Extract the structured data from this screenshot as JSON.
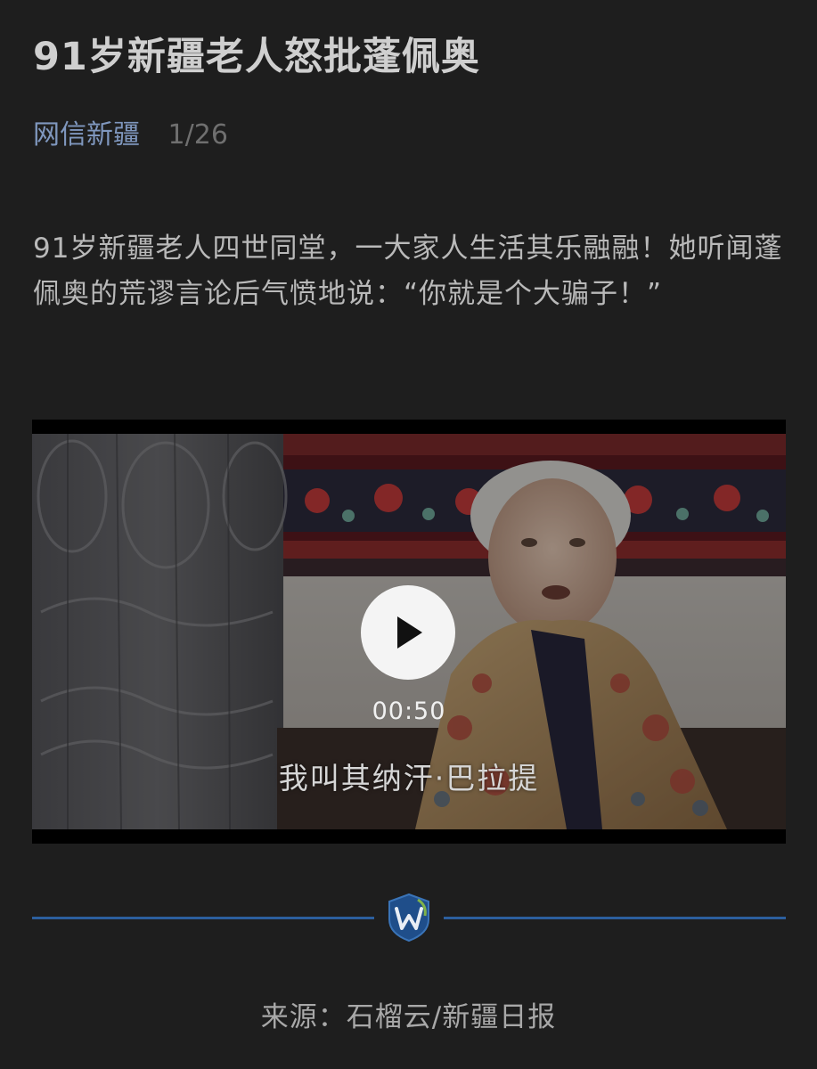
{
  "article": {
    "title": "91岁新疆老人怒批蓬佩奥",
    "account_name": "网信新疆",
    "page_counter": "1/26",
    "intro": "91岁新疆老人四世同堂，一大家人生活其乐融融！她听闻蓬佩奥的荒谬言论后气愤地说：“你就是个大骗子！”"
  },
  "video": {
    "duration": "00:50",
    "subtitle": "我叫其纳汗·巴拉提",
    "play_icon": "play-icon"
  },
  "divider": {
    "logo_icon": "w-shield-logo-icon",
    "line_color": "#2c5f9e"
  },
  "footer": {
    "source": "来源：石榴云/新疆日报"
  },
  "colors": {
    "background": "#1e1e1e",
    "title": "#cfcfcf",
    "account_link": "#7f97be",
    "body_text": "#b9b9b9"
  }
}
